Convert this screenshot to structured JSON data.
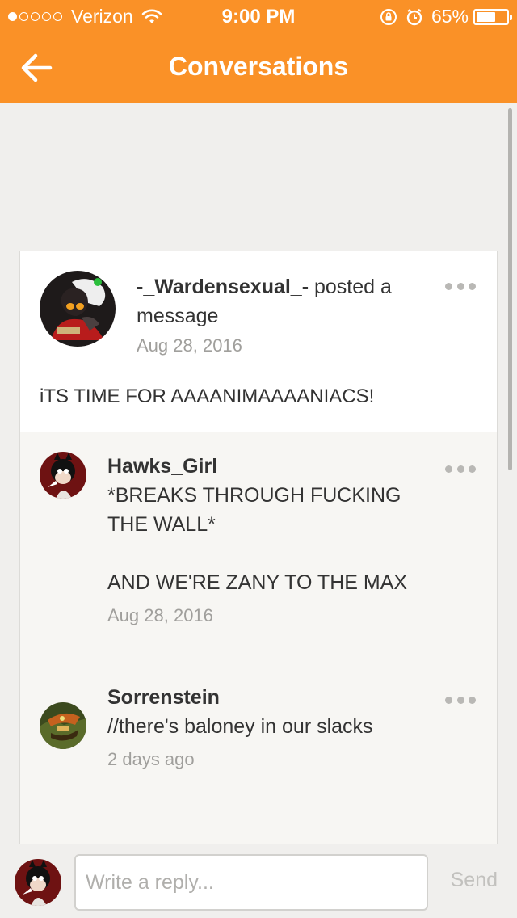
{
  "status_bar": {
    "carrier": "Verizon",
    "time": "9:00 PM",
    "battery": "65%",
    "battery_level": 0.65,
    "signal_dots_filled": 1,
    "signal_dots_total": 5
  },
  "header": {
    "title": "Conversations",
    "back_icon": "arrow-left-icon"
  },
  "post": {
    "username": "-_Wardensexual_-",
    "action": " posted a message",
    "date": "Aug 28, 2016",
    "body": "iTS TIME FOR AAAANIMAAAANIACS!"
  },
  "comments": [
    {
      "username": "Hawks_Girl",
      "body": "*BREAKS THROUGH FUCKING THE WALL*\n\nAND WE'RE ZANY TO THE MAX",
      "date": "Aug 28, 2016"
    },
    {
      "username": "Sorrenstein",
      "body": "//there's baloney in our slacks",
      "date": "2 days ago"
    }
  ],
  "reply": {
    "placeholder": "Write a reply...",
    "send_label": "Send"
  },
  "colors": {
    "accent": "#fa9127",
    "background": "#f0efed"
  }
}
